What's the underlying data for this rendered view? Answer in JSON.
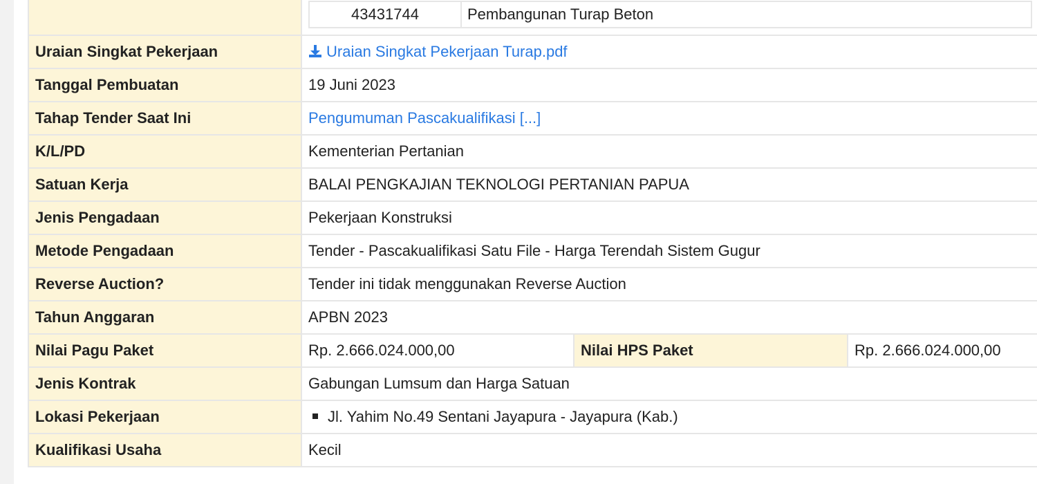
{
  "package": {
    "code": "43431744",
    "name": "Pembangunan Turap Beton"
  },
  "rows": {
    "uraian": {
      "label": "Uraian Singkat Pekerjaan",
      "file": "Uraian Singkat Pekerjaan Turap.pdf",
      "icon": "download-icon"
    },
    "tanggal": {
      "label": "Tanggal Pembuatan",
      "value": "19 Juni 2023"
    },
    "tahap": {
      "label": "Tahap Tender Saat Ini",
      "value": "Pengumuman Pascakualifikasi [...]"
    },
    "klpd": {
      "label": "K/L/PD",
      "value": "Kementerian Pertanian"
    },
    "satker": {
      "label": "Satuan Kerja",
      "value": "BALAI PENGKAJIAN TEKNOLOGI PERTANIAN PAPUA"
    },
    "jenis_pengadaan": {
      "label": "Jenis Pengadaan",
      "value": "Pekerjaan Konstruksi"
    },
    "metode": {
      "label": "Metode Pengadaan",
      "value": "Tender - Pascakualifikasi Satu File - Harga Terendah Sistem Gugur"
    },
    "reverse": {
      "label": "Reverse Auction?",
      "value": "Tender ini tidak menggunakan Reverse Auction"
    },
    "tahun": {
      "label": "Tahun Anggaran",
      "value": "APBN 2023"
    },
    "pagu": {
      "label": "Nilai Pagu Paket",
      "value": "Rp. 2.666.024.000,00",
      "hps_label": "Nilai HPS Paket",
      "hps_value": "Rp. 2.666.024.000,00"
    },
    "kontrak": {
      "label": "Jenis Kontrak",
      "value": "Gabungan Lumsum dan Harga Satuan"
    },
    "lokasi": {
      "label": "Lokasi Pekerjaan",
      "value": "Jl. Yahim No.49 Sentani Jayapura - Jayapura (Kab.)"
    },
    "kualifikasi": {
      "label": "Kualifikasi Usaha",
      "value": "Kecil"
    }
  },
  "colors": {
    "label_bg": "#fdf5d8",
    "link": "#2a7ae2",
    "border": "#e6e6e6"
  }
}
